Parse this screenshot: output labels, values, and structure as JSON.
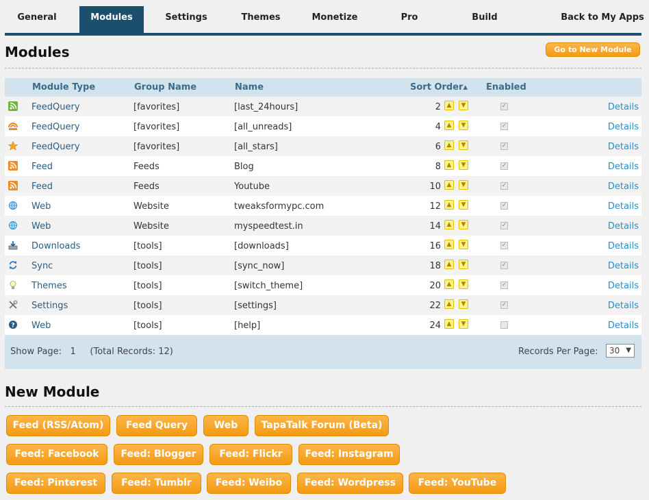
{
  "nav": {
    "tabs": [
      "General",
      "Modules",
      "Settings",
      "Themes",
      "Monetize",
      "Pro",
      "Build"
    ],
    "active": "Modules",
    "back": "Back to My Apps"
  },
  "modules": {
    "title": "Modules",
    "new_button": "Go to New Module",
    "columns": {
      "type": "Module Type",
      "group": "Group Name",
      "name": "Name",
      "sort": "Sort Order▴",
      "enabled": "Enabled"
    },
    "rows": [
      {
        "icon": "rss-green-icon",
        "type": "FeedQuery",
        "group": "[favorites]",
        "name": "[last_24hours]",
        "order": "2",
        "enabled": true,
        "details": "Details"
      },
      {
        "icon": "rss-unread-icon",
        "type": "FeedQuery",
        "group": "[favorites]",
        "name": "[all_unreads]",
        "order": "4",
        "enabled": true,
        "details": "Details"
      },
      {
        "icon": "star-icon",
        "type": "FeedQuery",
        "group": "[favorites]",
        "name": "[all_stars]",
        "order": "6",
        "enabled": true,
        "details": "Details"
      },
      {
        "icon": "rss-orange-icon",
        "type": "Feed",
        "group": "Feeds",
        "name": "Blog",
        "order": "8",
        "enabled": true,
        "details": "Details"
      },
      {
        "icon": "rss-orange-icon",
        "type": "Feed",
        "group": "Feeds",
        "name": "Youtube",
        "order": "10",
        "enabled": true,
        "details": "Details"
      },
      {
        "icon": "globe-icon",
        "type": "Web",
        "group": "Website",
        "name": "tweaksformypc.com",
        "order": "12",
        "enabled": true,
        "details": "Details"
      },
      {
        "icon": "globe-icon",
        "type": "Web",
        "group": "Website",
        "name": "myspeedtest.in",
        "order": "14",
        "enabled": true,
        "details": "Details"
      },
      {
        "icon": "download-icon",
        "type": "Downloads",
        "group": "[tools]",
        "name": "[downloads]",
        "order": "16",
        "enabled": true,
        "details": "Details"
      },
      {
        "icon": "sync-icon",
        "type": "Sync",
        "group": "[tools]",
        "name": "[sync_now]",
        "order": "18",
        "enabled": true,
        "details": "Details"
      },
      {
        "icon": "lightbulb-icon",
        "type": "Themes",
        "group": "[tools]",
        "name": "[switch_theme]",
        "order": "20",
        "enabled": true,
        "details": "Details"
      },
      {
        "icon": "tools-icon",
        "type": "Settings",
        "group": "[tools]",
        "name": "[settings]",
        "order": "22",
        "enabled": true,
        "details": "Details"
      },
      {
        "icon": "help-icon",
        "type": "Web",
        "group": "[tools]",
        "name": "[help]",
        "order": "24",
        "enabled": false,
        "details": "Details"
      }
    ],
    "footer": {
      "show_page_label": "Show Page:",
      "page": "1",
      "total": "(Total Records: 12)",
      "per_page_label": "Records Per Page:",
      "per_page_value": "30"
    }
  },
  "new_module": {
    "title": "New Module",
    "buttons": [
      "Feed (RSS/Atom)",
      "Feed Query",
      "Web",
      "TapaTalk Forum (Beta)",
      "Feed: Facebook",
      "Feed: Blogger",
      "Feed: Flickr",
      "Feed: Instagram",
      "Feed: Pinterest",
      "Feed: Tumblr",
      "Feed: Weibo",
      "Feed: Wordpress",
      "Feed: YouTube"
    ]
  },
  "colors": {
    "nav_active": "#1b4f6b",
    "accent_orange": "#f59a12",
    "link_blue": "#2e8bc7",
    "grid_header": "#d2e3ee"
  }
}
